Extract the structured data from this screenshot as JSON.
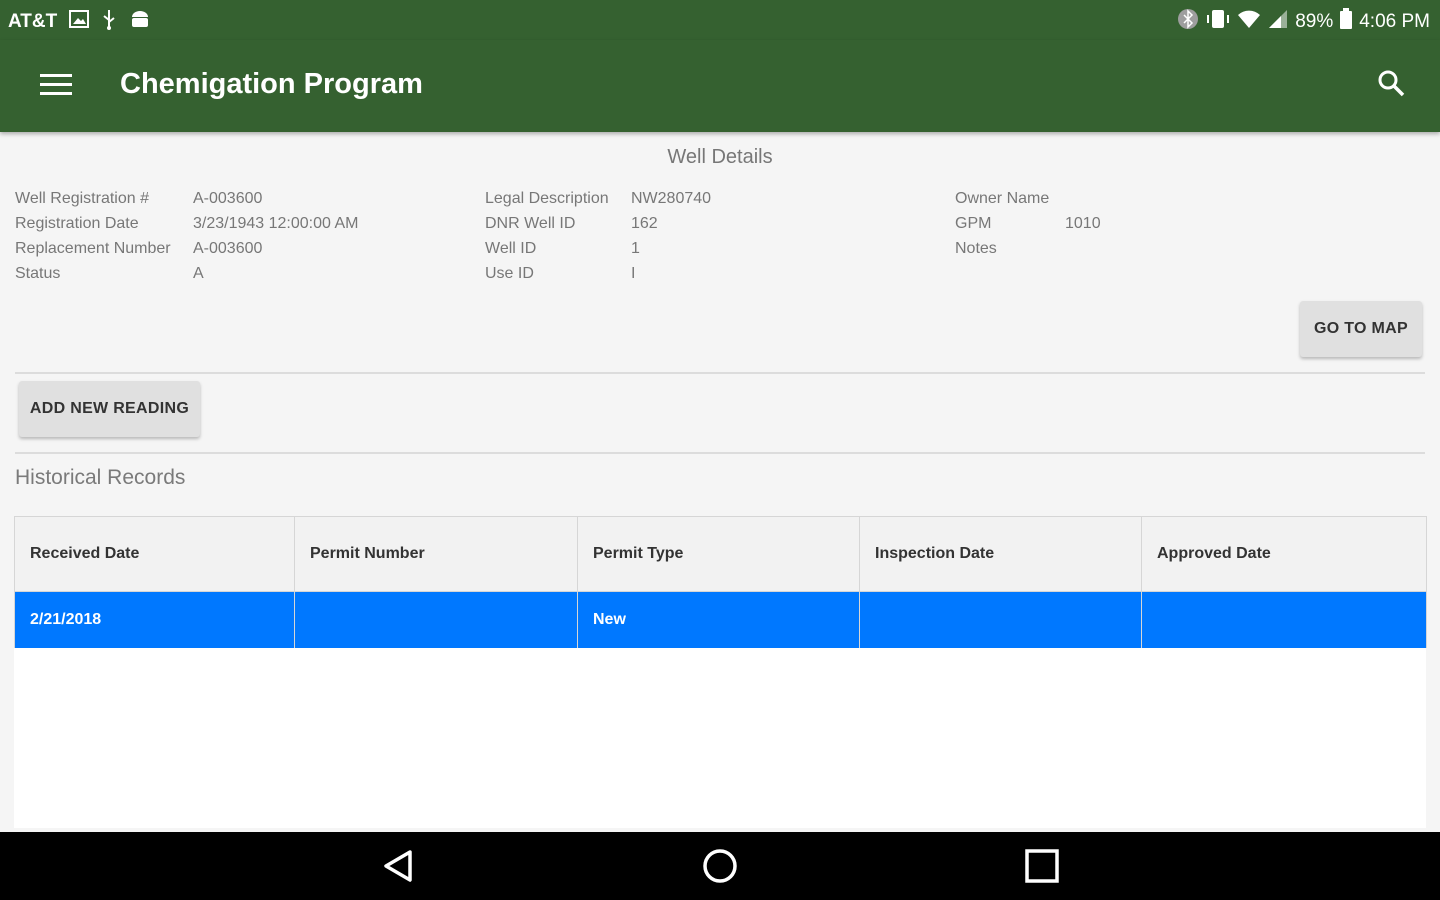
{
  "status_bar": {
    "carrier": "AT&T",
    "battery": "89%",
    "time": "4:06 PM",
    "left_icons": [
      "image-icon",
      "usb-icon",
      "android-icon"
    ],
    "right_icons": [
      "bluetooth-icon",
      "vibrate-icon",
      "wifi-icon",
      "signal-icon",
      "battery-icon"
    ]
  },
  "app_bar": {
    "title": "Chemigation Program",
    "background": "#356130",
    "icons": [
      "menu-icon",
      "search-icon"
    ]
  },
  "well_details": {
    "title": "Well Details",
    "col1": [
      {
        "label": "Well Registration #",
        "value": "A-003600"
      },
      {
        "label": "Registration Date",
        "value": "3/23/1943 12:00:00 AM"
      },
      {
        "label": "Replacement Number",
        "value": "A-003600"
      },
      {
        "label": "Status",
        "value": "A"
      }
    ],
    "col2": [
      {
        "label": "Legal Description",
        "value": "NW280740"
      },
      {
        "label": "DNR Well ID",
        "value": "162"
      },
      {
        "label": "Well ID",
        "value": "1"
      },
      {
        "label": "Use ID",
        "value": "I"
      }
    ],
    "col3": [
      {
        "label": "Owner Name",
        "value": ""
      },
      {
        "label": "GPM",
        "value": "1010"
      },
      {
        "label": "Notes",
        "value": ""
      }
    ],
    "go_to_map": "GO TO MAP"
  },
  "actions": {
    "add_new_reading": "ADD NEW READING"
  },
  "historical": {
    "title": "Historical Records",
    "columns": [
      "Received Date",
      "Permit Number",
      "Permit Type",
      "Inspection Date",
      "Approved Date"
    ],
    "rows": [
      [
        "2/21/2018",
        "",
        "New",
        "",
        ""
      ]
    ],
    "selected_row_color": "#0078ff"
  },
  "nav_bar": {
    "icons": [
      "back-icon",
      "home-icon",
      "recents-icon"
    ]
  }
}
